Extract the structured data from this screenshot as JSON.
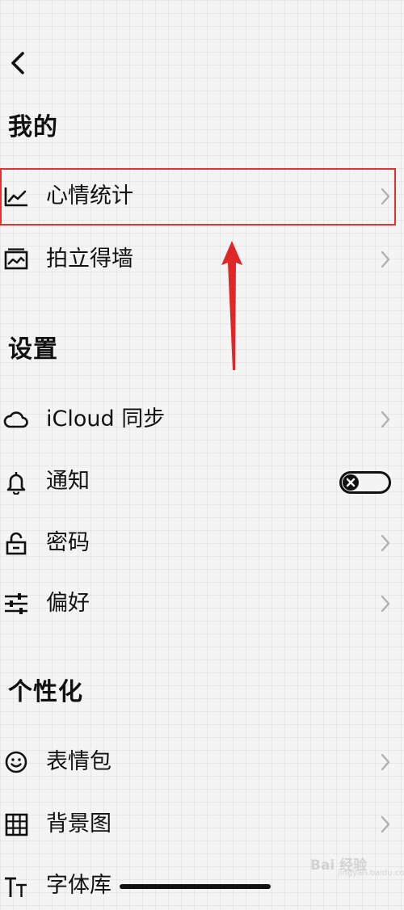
{
  "header": {
    "back_icon": "chevron-left-icon"
  },
  "sections": {
    "mine": {
      "title": "我的",
      "items": {
        "mood_stats": {
          "label": "心情统计",
          "icon": "line-chart-icon"
        },
        "photo_wall": {
          "label": "拍立得墙",
          "icon": "photo-icon"
        }
      }
    },
    "settings": {
      "title": "设置",
      "items": {
        "icloud": {
          "label": "iCloud 同步",
          "icon": "cloud-icon"
        },
        "notify": {
          "label": "通知",
          "icon": "bell-icon",
          "toggle_on": false
        },
        "password": {
          "label": "密码",
          "icon": "lock-icon"
        },
        "prefs": {
          "label": "偏好",
          "icon": "sliders-icon"
        }
      }
    },
    "personalize": {
      "title": "个性化",
      "items": {
        "stickers": {
          "label": "表情包",
          "icon": "smiley-icon"
        },
        "background": {
          "label": "背景图",
          "icon": "grid-icon"
        },
        "fonts": {
          "label": "字体库",
          "icon": "text-size-icon"
        }
      }
    }
  },
  "annotation": {
    "highlight_color": "#e6322e",
    "target": "心情统计"
  },
  "watermark": {
    "text": "Bai 经验",
    "sub": "jingyan.baidu.com"
  }
}
